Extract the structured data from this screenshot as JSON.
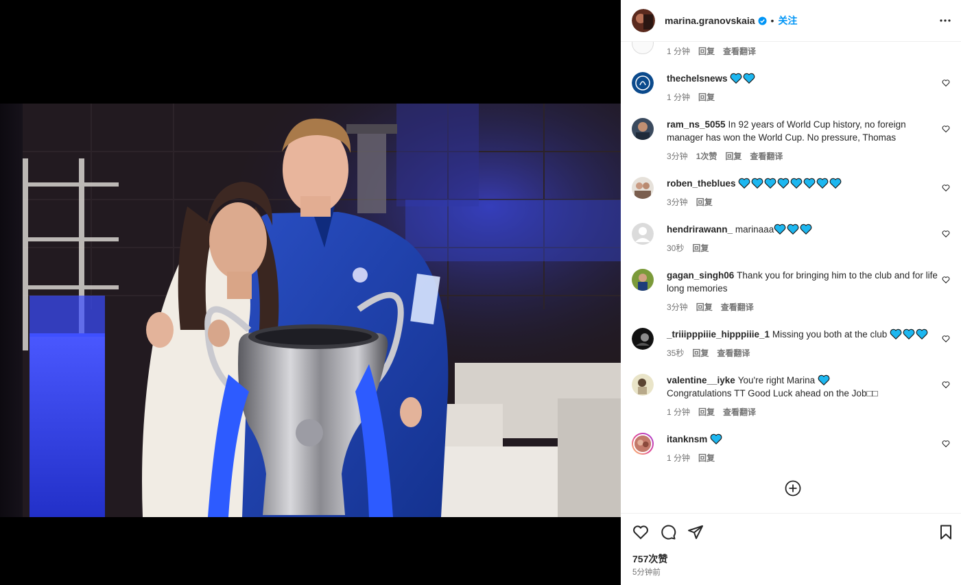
{
  "post": {
    "username": "marina.granovskaia",
    "separator": "•",
    "follow_label": "关注",
    "likes": "757次赞",
    "time": "5分钟前"
  },
  "icons": {
    "verified": "verified-badge-icon",
    "more": "more-options-icon",
    "heart": "heart-icon",
    "comment": "comment-icon",
    "share": "share-icon",
    "save": "bookmark-icon",
    "load_more": "plus-circle-icon"
  },
  "colors": {
    "accent": "#0095f6",
    "heart_emoji": "#1db7f0",
    "muted_text": "#737373"
  },
  "comments": [
    {
      "username": "",
      "text": "",
      "hearts": 0,
      "meta": [
        "1 分钟",
        "回复",
        "查看翻译"
      ]
    },
    {
      "username": "thechelsnews",
      "text": "",
      "hearts": 2,
      "meta": [
        "1 分钟",
        "回复"
      ]
    },
    {
      "username": "ram_ns_5055",
      "text": "In 92 years of World Cup history, no foreign manager has won the World Cup. No pressure, Thomas",
      "hearts": 0,
      "meta": [
        "3分钟",
        "1次赞",
        "回复",
        "查看翻译"
      ]
    },
    {
      "username": "roben_theblues",
      "text": "",
      "hearts": 8,
      "meta": [
        "3分钟",
        "回复"
      ]
    },
    {
      "username": "hendrirawann_",
      "text": "marinaaa",
      "hearts": 3,
      "meta": [
        "30秒",
        "回复"
      ]
    },
    {
      "username": "gagan_singh06",
      "text": "Thank you for bringing him to the club and for life long memories",
      "hearts": 0,
      "meta": [
        "3分钟",
        "回复",
        "查看翻译"
      ]
    },
    {
      "username": "_triiipppiiie_hipppiiie_1",
      "text": "Missing you both at the club",
      "hearts": 3,
      "meta": [
        "35秒",
        "回复",
        "查看翻译"
      ]
    },
    {
      "username": "valentine__iyke",
      "text": "You're right Marina",
      "text2": "Congratulations TT Good Luck ahead on the Job□□",
      "hearts": 1,
      "meta": [
        "1 分钟",
        "回复",
        "查看翻译"
      ]
    },
    {
      "username": "itanknsm",
      "text": "",
      "hearts": 1,
      "meta": [
        "1 分钟",
        "回复"
      ]
    }
  ]
}
